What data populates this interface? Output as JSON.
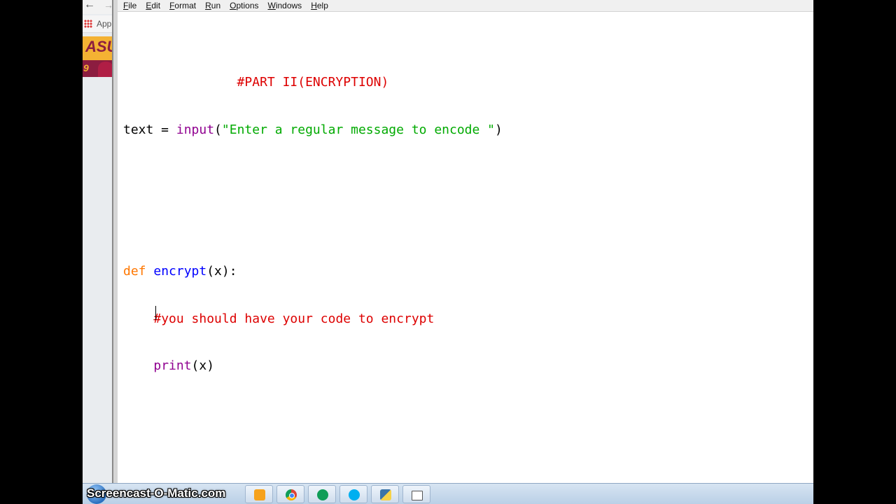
{
  "browser": {
    "apps_label": "App",
    "asu_logo_text": "ASU",
    "asu_number": "9"
  },
  "menu": [
    {
      "first": "F",
      "rest": "ile"
    },
    {
      "first": "E",
      "rest": "dit"
    },
    {
      "first": "F",
      "rest": "ormat"
    },
    {
      "first": "R",
      "rest": "un"
    },
    {
      "first": "O",
      "rest": "ptions"
    },
    {
      "first": "W",
      "rest": "indows"
    },
    {
      "first": "H",
      "rest": "elp"
    }
  ],
  "code": {
    "line1_comment": "               #PART II(ENCRYPTION)",
    "line2_var": "text = ",
    "line2_func": "input",
    "line2_open": "(",
    "line2_string": "\"Enter a regular message to encode \"",
    "line2_close": ")",
    "line5_kw": "def",
    "line5_name": "encrypt",
    "line5_sig": "(x):",
    "line6_indent": "    ",
    "line6_hash": "#",
    "line6_comment": "you should have your code to encrypt",
    "line7_indent": "    ",
    "line7_func": "print",
    "line7_args": "(x)"
  },
  "watermark": "Screencast-O-Matic.com",
  "taskbar_icons": [
    "vlc-icon",
    "chrome-icon",
    "hangouts-icon",
    "skype-icon",
    "python-icon",
    "window-icon"
  ],
  "colors": {
    "keyword": "#ff7700",
    "builtin": "#900090",
    "string": "#00aa00",
    "comment": "#dd0000",
    "definition": "#0000ff"
  }
}
